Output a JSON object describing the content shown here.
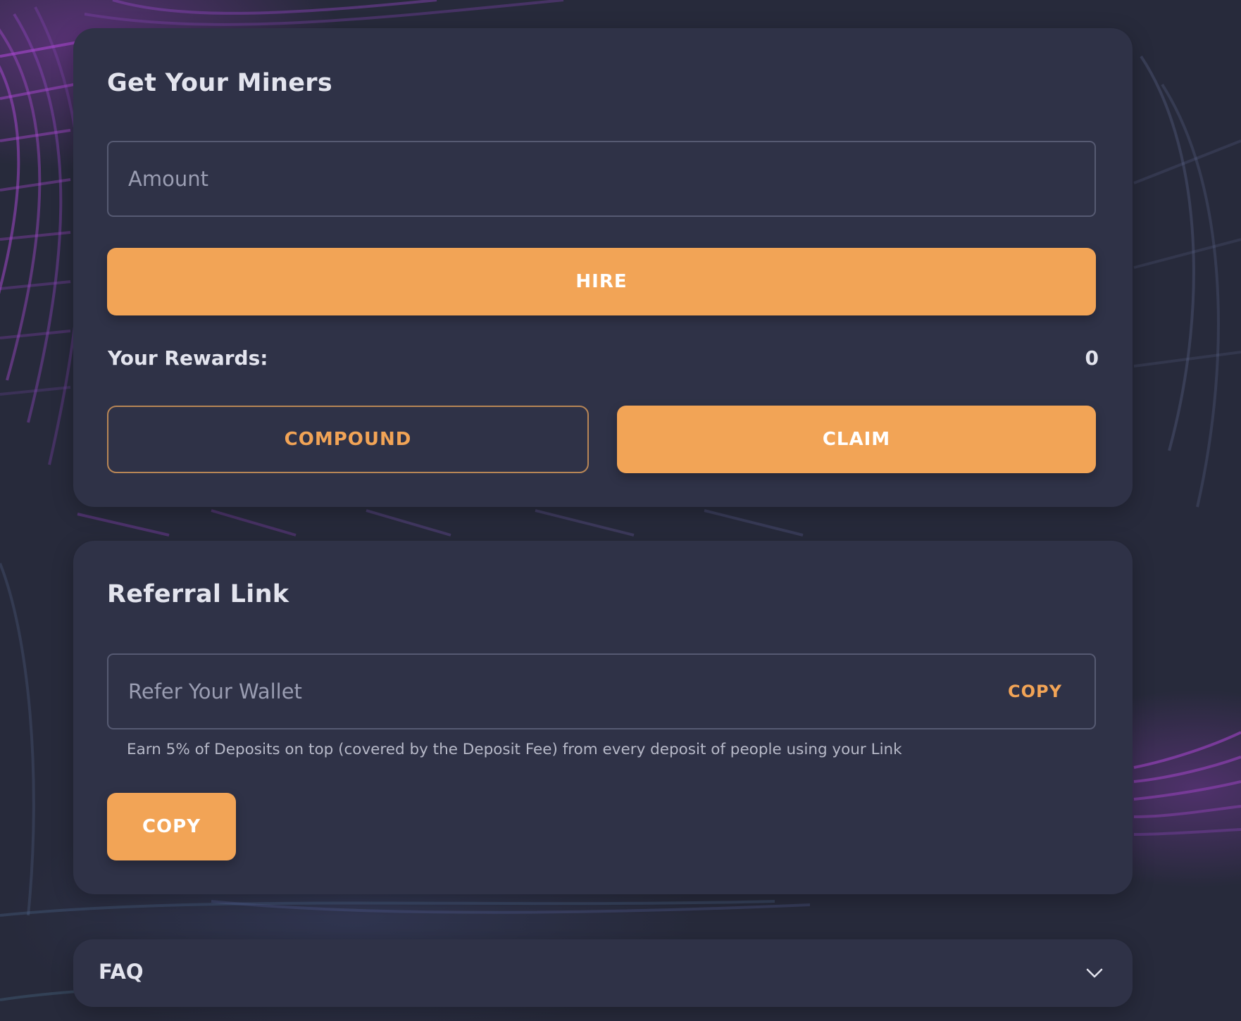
{
  "miners_card": {
    "title": "Get Your Miners",
    "amount_placeholder": "Amount",
    "amount_value": "",
    "hire_label": "HIRE",
    "rewards_label": "Your Rewards:",
    "rewards_value": "0",
    "compound_label": "COMPOUND",
    "claim_label": "CLAIM"
  },
  "referral_card": {
    "title": "Referral Link",
    "link_placeholder": "Refer Your Wallet",
    "link_value": "",
    "inline_copy_label": "COPY",
    "hint": "Earn 5% of Deposits on top (covered by the Deposit Fee) from every deposit of people using your Link",
    "copy_button_label": "COPY"
  },
  "faq": {
    "label": "FAQ",
    "toggle_icon": "chevron-down-icon"
  },
  "colors": {
    "background": "#272a3b",
    "card": "#2f3247",
    "accent": "#f2a456",
    "text": "#e3e4ee",
    "muted_text": "#9a9db2"
  }
}
